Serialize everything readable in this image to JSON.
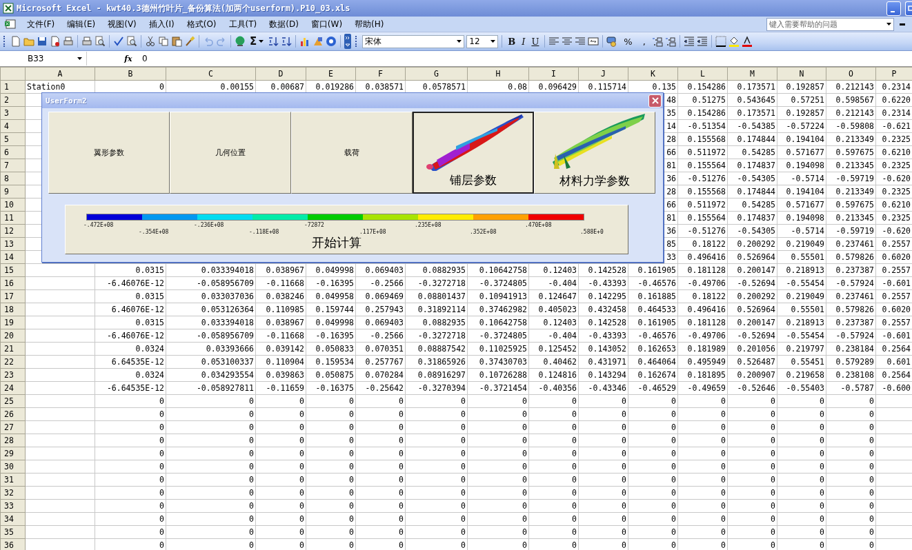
{
  "window": {
    "title": "Microsoft Excel - kwt40.3德州竹叶片_备份算法(加两个userform).P10_03.xls"
  },
  "menu": [
    "文件(F)",
    "编辑(E)",
    "视图(V)",
    "插入(I)",
    "格式(O)",
    "工具(T)",
    "数据(D)",
    "窗口(W)",
    "帮助(H)"
  ],
  "help_box": {
    "placeholder": "键入需要帮助的问题"
  },
  "standard_toolbar": {
    "sum_label": "Σ"
  },
  "formatting_toolbar": {
    "font": "宋体",
    "size": "12",
    "bold_label": "B",
    "italic_label": "I",
    "underline_label": "U",
    "percent_label": "%",
    "comma_label": ","
  },
  "formula_bar": {
    "name_box": "B33",
    "fx_label": "fx",
    "value": "0"
  },
  "columns": [
    "A",
    "B",
    "C",
    "D",
    "E",
    "F",
    "G",
    "H",
    "I",
    "J",
    "K",
    "L",
    "M",
    "N",
    "O",
    "P"
  ],
  "rows": [
    {
      "number": "1",
      "cells": {
        "A": "Station0",
        "B": "0",
        "C": "0.00155",
        "D": "0.00687",
        "E": "0.019286",
        "F": "0.038571",
        "G": "0.0578571",
        "H": "0.08",
        "I": "0.096429",
        "J": "0.115714",
        "K": "0.135",
        "L": "0.154286",
        "M": "0.173571",
        "N": "0.192857",
        "O": "0.212143",
        "P": "0.2314"
      }
    },
    {
      "number": "2",
      "cells": {
        "K": "48",
        "L": "0.51275",
        "M": "0.543645",
        "N": "0.57251",
        "O": "0.598567",
        "P": "0.6220"
      }
    },
    {
      "number": "3",
      "cells": {
        "K": "35",
        "L": "0.154286",
        "M": "0.173571",
        "N": "0.192857",
        "O": "0.212143",
        "P": "0.2314"
      }
    },
    {
      "number": "4",
      "cells": {
        "K": "14",
        "L": "-0.51354",
        "M": "-0.54385",
        "N": "-0.57224",
        "O": "-0.59808",
        "P": "-0.621"
      }
    },
    {
      "number": "5",
      "cells": {
        "K": "28",
        "L": "0.155568",
        "M": "0.174844",
        "N": "0.194104",
        "O": "0.213349",
        "P": "0.2325"
      }
    },
    {
      "number": "6",
      "cells": {
        "K": "66",
        "L": "0.511972",
        "M": "0.54285",
        "N": "0.571677",
        "O": "0.597675",
        "P": "0.6210"
      }
    },
    {
      "number": "7",
      "cells": {
        "K": "81",
        "L": "0.155564",
        "M": "0.174837",
        "N": "0.194098",
        "O": "0.213345",
        "P": "0.2325"
      }
    },
    {
      "number": "8",
      "cells": {
        "K": "36",
        "L": "-0.51276",
        "M": "-0.54305",
        "N": "-0.5714",
        "O": "-0.59719",
        "P": "-0.620"
      }
    },
    {
      "number": "9",
      "cells": {
        "K": "28",
        "L": "0.155568",
        "M": "0.174844",
        "N": "0.194104",
        "O": "0.213349",
        "P": "0.2325"
      }
    },
    {
      "number": "10",
      "cells": {
        "K": "66",
        "L": "0.511972",
        "M": "0.54285",
        "N": "0.571677",
        "O": "0.597675",
        "P": "0.6210"
      }
    },
    {
      "number": "11",
      "cells": {
        "K": "81",
        "L": "0.155564",
        "M": "0.174837",
        "N": "0.194098",
        "O": "0.213345",
        "P": "0.2325"
      }
    },
    {
      "number": "12",
      "cells": {
        "K": "36",
        "L": "-0.51276",
        "M": "-0.54305",
        "N": "-0.5714",
        "O": "-0.59719",
        "P": "-0.620"
      }
    },
    {
      "number": "13",
      "cells": {
        "K": "85",
        "L": "0.18122",
        "M": "0.200292",
        "N": "0.219049",
        "O": "0.237461",
        "P": "0.2557"
      }
    },
    {
      "number": "14",
      "cells": {
        "K": "33",
        "L": "0.496416",
        "M": "0.526964",
        "N": "0.55501",
        "O": "0.579826",
        "P": "0.6020"
      }
    },
    {
      "number": "15",
      "cells": {
        "B": "0.0315",
        "C": "0.033394018",
        "D": "0.038967",
        "E": "0.049998",
        "F": "0.069403",
        "G": "0.0882935",
        "H": "0.10642758",
        "I": "0.12403",
        "J": "0.142528",
        "K": "0.161905",
        "L": "0.181128",
        "M": "0.200147",
        "N": "0.218913",
        "O": "0.237387",
        "P": "0.2557"
      }
    },
    {
      "number": "16",
      "cells": {
        "B": "-6.46076E-12",
        "C": "-0.058956709",
        "D": "-0.11668",
        "E": "-0.16395",
        "F": "-0.2566",
        "G": "-0.3272718",
        "H": "-0.3724805",
        "I": "-0.404",
        "J": "-0.43393",
        "K": "-0.46576",
        "L": "-0.49706",
        "M": "-0.52694",
        "N": "-0.55454",
        "O": "-0.57924",
        "P": "-0.601"
      }
    },
    {
      "number": "17",
      "cells": {
        "B": "0.0315",
        "C": "0.033037036",
        "D": "0.038246",
        "E": "0.049958",
        "F": "0.069469",
        "G": "0.08801437",
        "H": "0.10941913",
        "I": "0.124647",
        "J": "0.142295",
        "K": "0.161885",
        "L": "0.18122",
        "M": "0.200292",
        "N": "0.219049",
        "O": "0.237461",
        "P": "0.2557"
      }
    },
    {
      "number": "18",
      "cells": {
        "B": "6.46076E-12",
        "C": "0.053126364",
        "D": "0.110985",
        "E": "0.159744",
        "F": "0.257943",
        "G": "0.31892114",
        "H": "0.37462982",
        "I": "0.405023",
        "J": "0.432458",
        "K": "0.464533",
        "L": "0.496416",
        "M": "0.526964",
        "N": "0.55501",
        "O": "0.579826",
        "P": "0.6020"
      }
    },
    {
      "number": "19",
      "cells": {
        "B": "0.0315",
        "C": "0.033394018",
        "D": "0.038967",
        "E": "0.049998",
        "F": "0.069403",
        "G": "0.0882935",
        "H": "0.10642758",
        "I": "0.12403",
        "J": "0.142528",
        "K": "0.161905",
        "L": "0.181128",
        "M": "0.200147",
        "N": "0.218913",
        "O": "0.237387",
        "P": "0.2557"
      }
    },
    {
      "number": "20",
      "cells": {
        "B": "-6.46076E-12",
        "C": "-0.058956709",
        "D": "-0.11668",
        "E": "-0.16395",
        "F": "-0.2566",
        "G": "-0.3272718",
        "H": "-0.3724805",
        "I": "-0.404",
        "J": "-0.43393",
        "K": "-0.46576",
        "L": "-0.49706",
        "M": "-0.52694",
        "N": "-0.55454",
        "O": "-0.57924",
        "P": "-0.601"
      }
    },
    {
      "number": "21",
      "cells": {
        "B": "0.0324",
        "C": "0.03393666",
        "D": "0.039142",
        "E": "0.050833",
        "F": "0.070351",
        "G": "0.08887542",
        "H": "0.11025925",
        "I": "0.125452",
        "J": "0.143052",
        "K": "0.162653",
        "L": "0.181989",
        "M": "0.201056",
        "N": "0.219797",
        "O": "0.238184",
        "P": "0.2564"
      }
    },
    {
      "number": "22",
      "cells": {
        "B": "6.64535E-12",
        "C": "0.053100337",
        "D": "0.110904",
        "E": "0.159534",
        "F": "0.257767",
        "G": "0.31865926",
        "H": "0.37430703",
        "I": "0.40462",
        "J": "0.431971",
        "K": "0.464064",
        "L": "0.495949",
        "M": "0.526487",
        "N": "0.55451",
        "O": "0.579289",
        "P": "0.601"
      }
    },
    {
      "number": "23",
      "cells": {
        "B": "0.0324",
        "C": "0.034293554",
        "D": "0.039863",
        "E": "0.050875",
        "F": "0.070284",
        "G": "0.08916297",
        "H": "0.10726288",
        "I": "0.124816",
        "J": "0.143294",
        "K": "0.162674",
        "L": "0.181895",
        "M": "0.200907",
        "N": "0.219658",
        "O": "0.238108",
        "P": "0.2564"
      }
    },
    {
      "number": "24",
      "cells": {
        "B": "-6.64535E-12",
        "C": "-0.058927811",
        "D": "-0.11659",
        "E": "-0.16375",
        "F": "-0.25642",
        "G": "-0.3270394",
        "H": "-0.3721454",
        "I": "-0.40356",
        "J": "-0.43346",
        "K": "-0.46529",
        "L": "-0.49659",
        "M": "-0.52646",
        "N": "-0.55403",
        "O": "-0.5787",
        "P": "-0.600"
      }
    },
    {
      "number": "25",
      "cells": {
        "B": "0",
        "C": "0",
        "D": "0",
        "E": "0",
        "F": "0",
        "G": "0",
        "H": "0",
        "I": "0",
        "J": "0",
        "K": "0",
        "L": "0",
        "M": "0",
        "N": "0",
        "O": "0"
      }
    },
    {
      "number": "26",
      "cells": {
        "B": "0",
        "C": "0",
        "D": "0",
        "E": "0",
        "F": "0",
        "G": "0",
        "H": "0",
        "I": "0",
        "J": "0",
        "K": "0",
        "L": "0",
        "M": "0",
        "N": "0",
        "O": "0"
      }
    },
    {
      "number": "27",
      "cells": {
        "B": "0",
        "C": "0",
        "D": "0",
        "E": "0",
        "F": "0",
        "G": "0",
        "H": "0",
        "I": "0",
        "J": "0",
        "K": "0",
        "L": "0",
        "M": "0",
        "N": "0",
        "O": "0"
      }
    },
    {
      "number": "28",
      "cells": {
        "B": "0",
        "C": "0",
        "D": "0",
        "E": "0",
        "F": "0",
        "G": "0",
        "H": "0",
        "I": "0",
        "J": "0",
        "K": "0",
        "L": "0",
        "M": "0",
        "N": "0",
        "O": "0"
      }
    },
    {
      "number": "29",
      "cells": {
        "B": "0",
        "C": "0",
        "D": "0",
        "E": "0",
        "F": "0",
        "G": "0",
        "H": "0",
        "I": "0",
        "J": "0",
        "K": "0",
        "L": "0",
        "M": "0",
        "N": "0",
        "O": "0"
      }
    },
    {
      "number": "30",
      "cells": {
        "B": "0",
        "C": "0",
        "D": "0",
        "E": "0",
        "F": "0",
        "G": "0",
        "H": "0",
        "I": "0",
        "J": "0",
        "K": "0",
        "L": "0",
        "M": "0",
        "N": "0",
        "O": "0"
      }
    },
    {
      "number": "31",
      "cells": {
        "B": "0",
        "C": "0",
        "D": "0",
        "E": "0",
        "F": "0",
        "G": "0",
        "H": "0",
        "I": "0",
        "J": "0",
        "K": "0",
        "L": "0",
        "M": "0",
        "N": "0",
        "O": "0"
      }
    },
    {
      "number": "32",
      "cells": {
        "B": "0",
        "C": "0",
        "D": "0",
        "E": "0",
        "F": "0",
        "G": "0",
        "H": "0",
        "I": "0",
        "J": "0",
        "K": "0",
        "L": "0",
        "M": "0",
        "N": "0",
        "O": "0"
      }
    },
    {
      "number": "33",
      "cells": {
        "B": "0",
        "C": "0",
        "D": "0",
        "E": "0",
        "F": "0",
        "G": "0",
        "H": "0",
        "I": "0",
        "J": "0",
        "K": "0",
        "L": "0",
        "M": "0",
        "N": "0",
        "O": "0"
      }
    },
    {
      "number": "34",
      "cells": {
        "B": "0",
        "C": "0",
        "D": "0",
        "E": "0",
        "F": "0",
        "G": "0",
        "H": "0",
        "I": "0",
        "J": "0",
        "K": "0",
        "L": "0",
        "M": "0",
        "N": "0",
        "O": "0"
      }
    },
    {
      "number": "35",
      "cells": {
        "B": "0",
        "C": "0",
        "D": "0",
        "E": "0",
        "F": "0",
        "G": "0",
        "H": "0",
        "I": "0",
        "J": "0",
        "K": "0",
        "L": "0",
        "M": "0",
        "N": "0",
        "O": "0"
      }
    },
    {
      "number": "36",
      "cells": {
        "B": "0",
        "C": "0",
        "D": "0",
        "E": "0",
        "F": "0",
        "G": "0",
        "H": "0",
        "I": "0",
        "J": "0",
        "K": "0",
        "L": "0",
        "M": "0",
        "N": "0",
        "O": "0"
      }
    }
  ],
  "userform": {
    "title": "UserForm2",
    "buttons": [
      {
        "label": "翼形参数",
        "kind": "text",
        "selected": false
      },
      {
        "label": "几何位置",
        "kind": "text",
        "selected": false
      },
      {
        "label": "载荷",
        "kind": "text",
        "selected": false
      },
      {
        "label": "铺层参数",
        "kind": "picture",
        "selected": true
      },
      {
        "label": "材料力学参数",
        "kind": "picture",
        "selected": false
      }
    ],
    "start_button": {
      "label": "开始计算",
      "legend": {
        "colors": [
          {
            "color": "#0000d8"
          },
          {
            "color": "#0098f0"
          },
          {
            "color": "#00dcf0"
          },
          {
            "color": "#00eca8"
          },
          {
            "color": "#00cc00"
          },
          {
            "color": "#a8e400"
          },
          {
            "color": "#ffec00"
          },
          {
            "color": "#ffa000"
          },
          {
            "color": "#f00000"
          }
        ],
        "labels": [
          "-.472E+08",
          "-.354E+08",
          "-.236E+08",
          "-.118E+08",
          "-72872",
          ".117E+08",
          ".235E+08",
          ".352E+08",
          ".470E+08",
          ".588E+0"
        ]
      }
    }
  }
}
